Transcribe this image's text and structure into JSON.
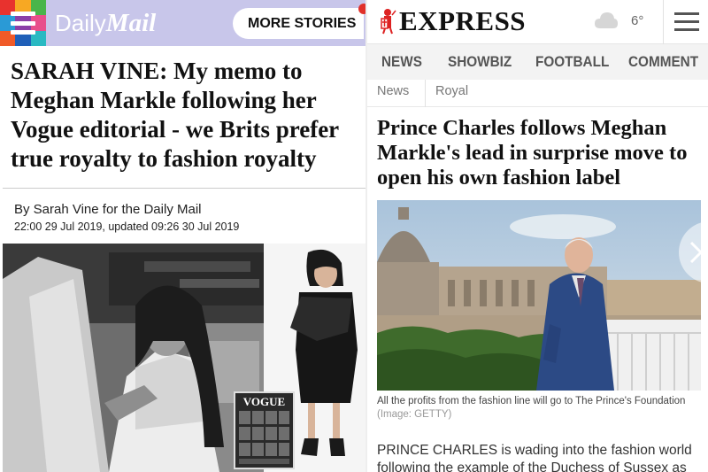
{
  "daily_mail": {
    "brand": {
      "prefix": "Daily",
      "emphasis": "Mail"
    },
    "more_stories_label": "MORE STORIES",
    "menu_colors": [
      "#e8322e",
      "#f7a823",
      "#49b54a",
      "#2a9ad6",
      "#8b3fa8",
      "#e84f8b",
      "#f05a28",
      "#1f5fb8",
      "#29b9c2"
    ],
    "header_color": "#c8c6ea",
    "headline": "SARAH VINE: My memo to Meghan Markle following her Vogue editorial - we Brits prefer true royalty to fashion royalty",
    "byline": "By Sarah Vine for the Daily Mail",
    "date": "22:00 29 Jul 2019, updated 09:26 30 Jul 2019",
    "cover_masthead": "VOGUE"
  },
  "express": {
    "logo": "EXPRESS",
    "weather": {
      "icon": "cloud-icon",
      "temp": "6°"
    },
    "nav": [
      "NEWS",
      "SHOWBIZ",
      "FOOTBALL",
      "COMMENT"
    ],
    "breadcrumbs": [
      "News",
      "Royal"
    ],
    "headline": "Prince Charles follows Meghan Markle's lead in surprise move to open his own fashion label",
    "caption": "All the profits from the fashion line will go to The Prince's Foundation",
    "caption_source": "(Image: GETTY)",
    "body": "PRINCE CHARLES is wading into the fashion world following the example of the Duchess of Sussex as"
  }
}
